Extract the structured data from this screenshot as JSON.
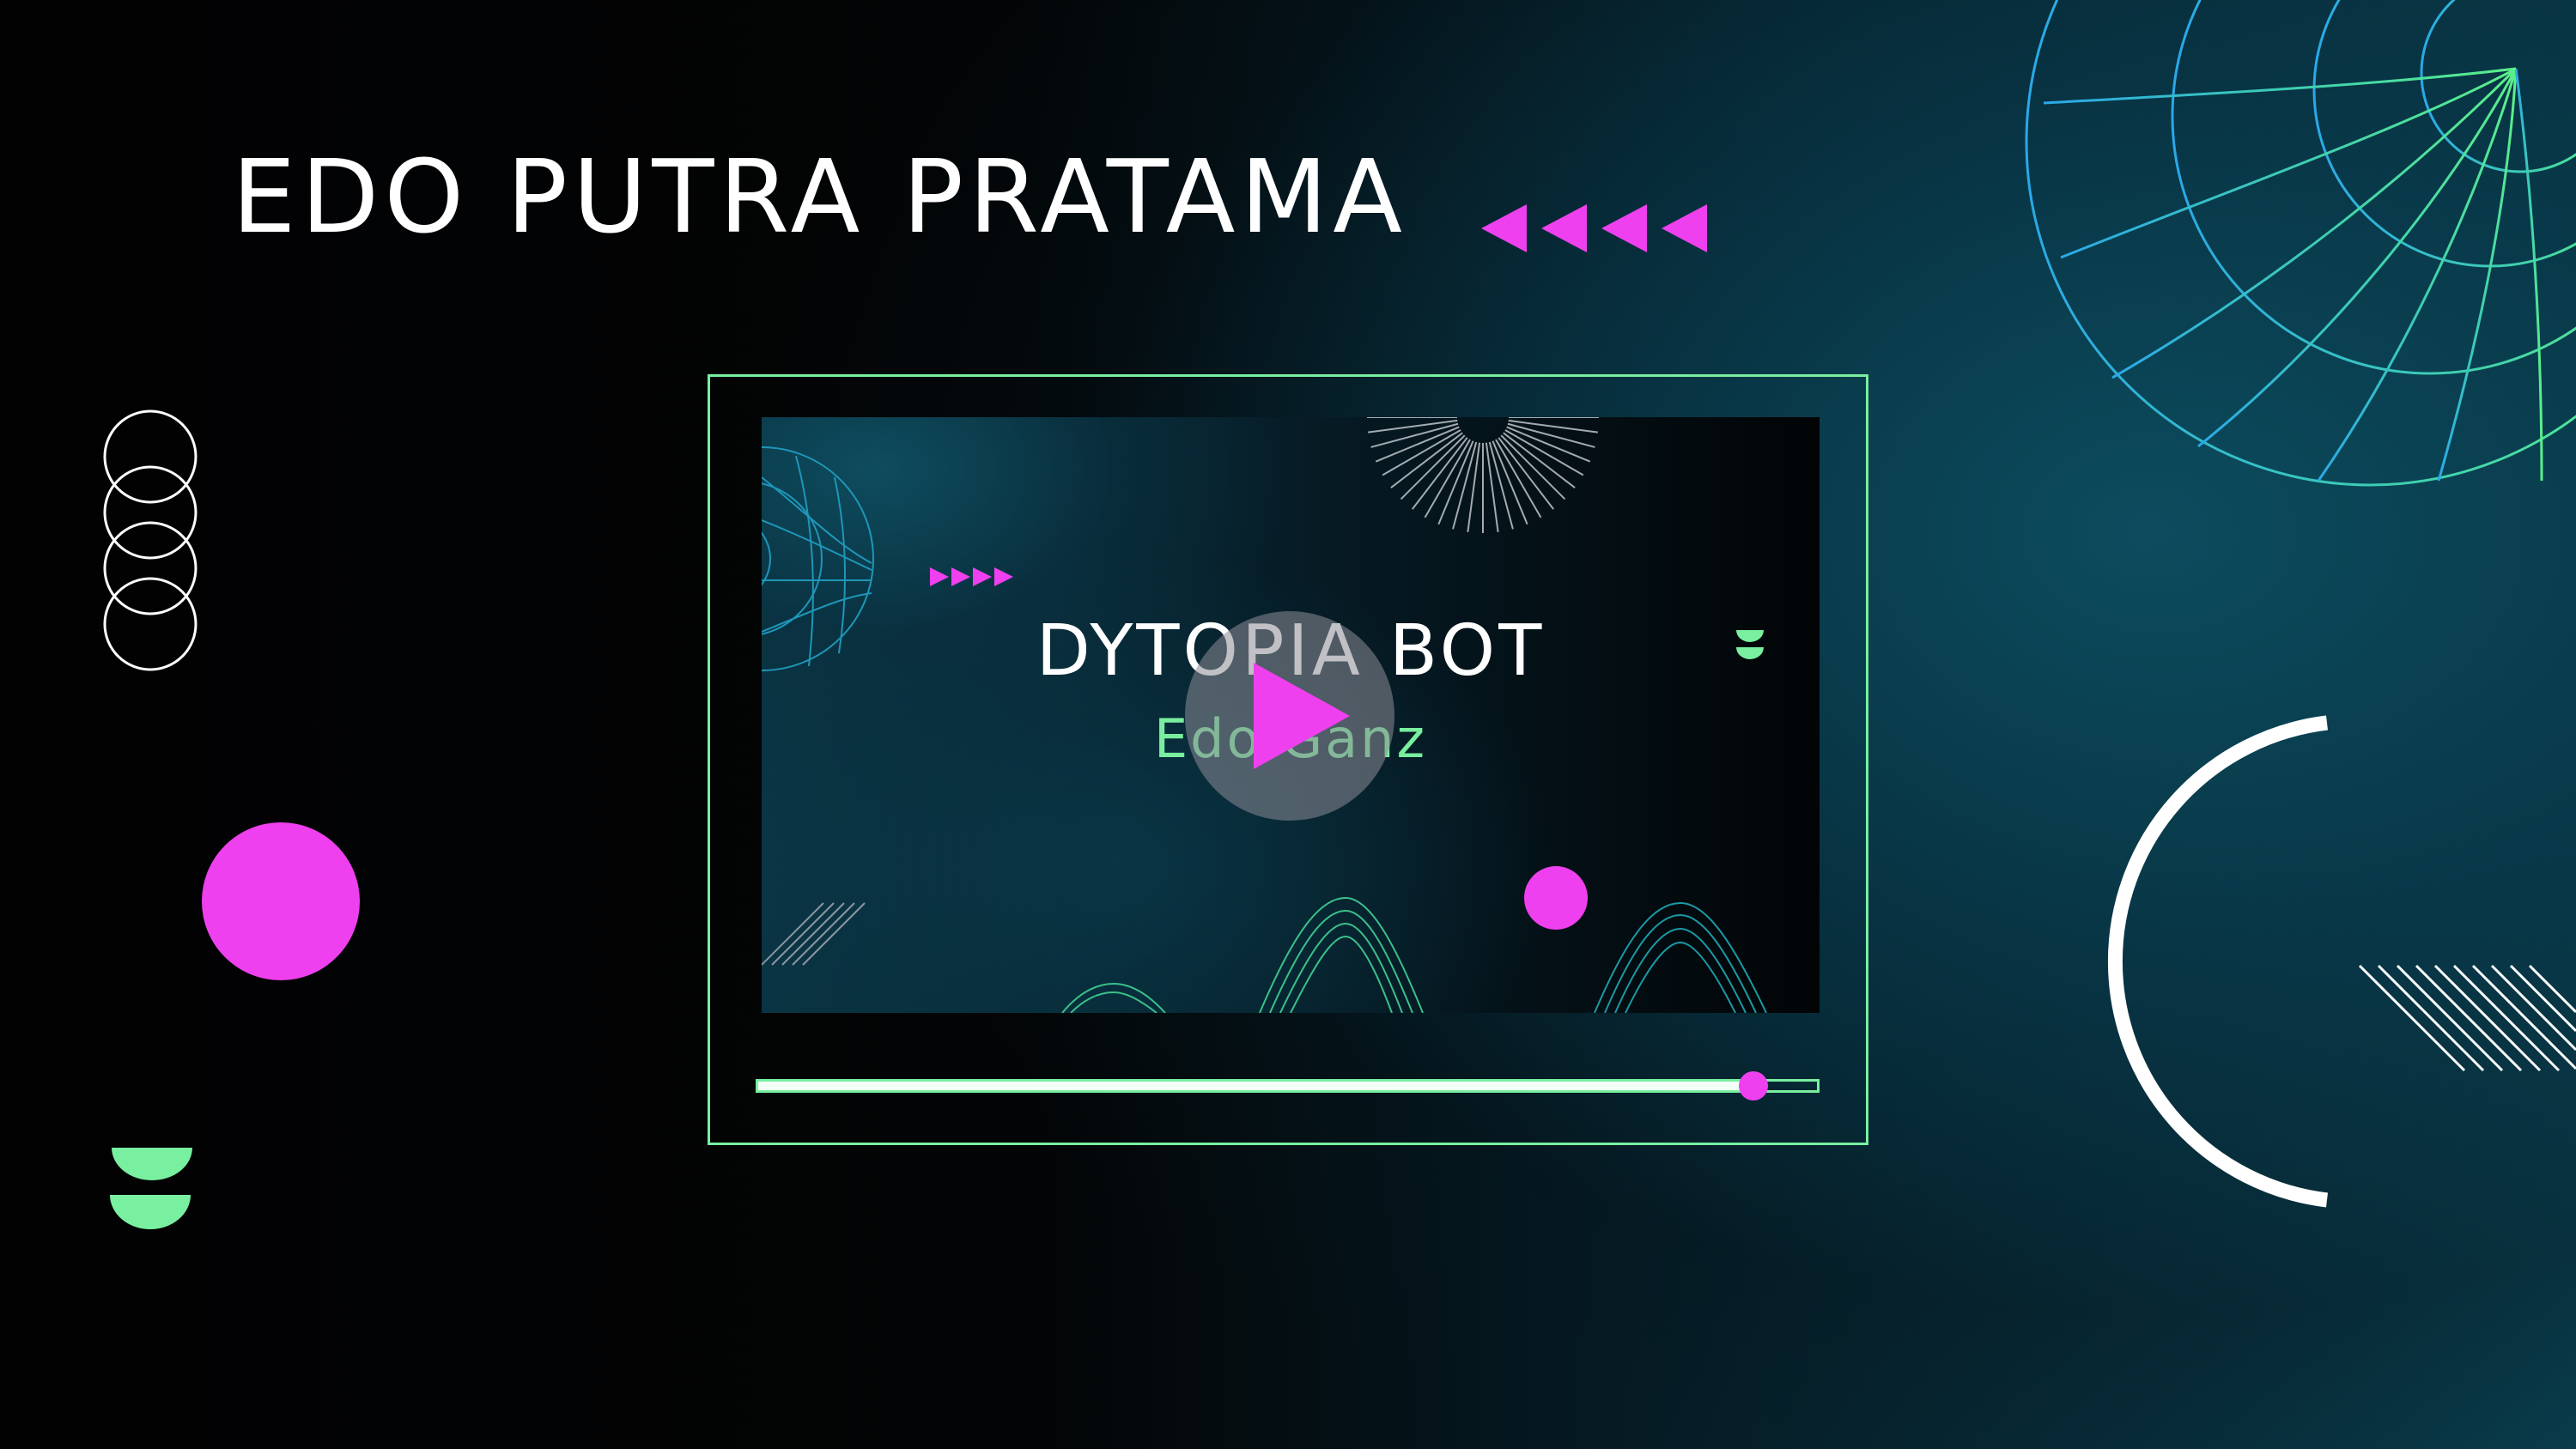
{
  "page": {
    "title": "EDO PUTRA PRATAMA"
  },
  "player": {
    "video_title": "DYTOPIA BOT",
    "video_subtitle": "Edo Ganz",
    "progress": 0.94
  },
  "icons": {
    "play": "play-icon",
    "rewind_arrows": "rewind-arrows-icon",
    "globe": "wireframe-globe-icon"
  },
  "colors": {
    "accent_pink": "#ee40ee",
    "accent_green": "#78f0a0",
    "text": "#ffffff",
    "background": "#030405",
    "teal": "#0a3f4f"
  }
}
